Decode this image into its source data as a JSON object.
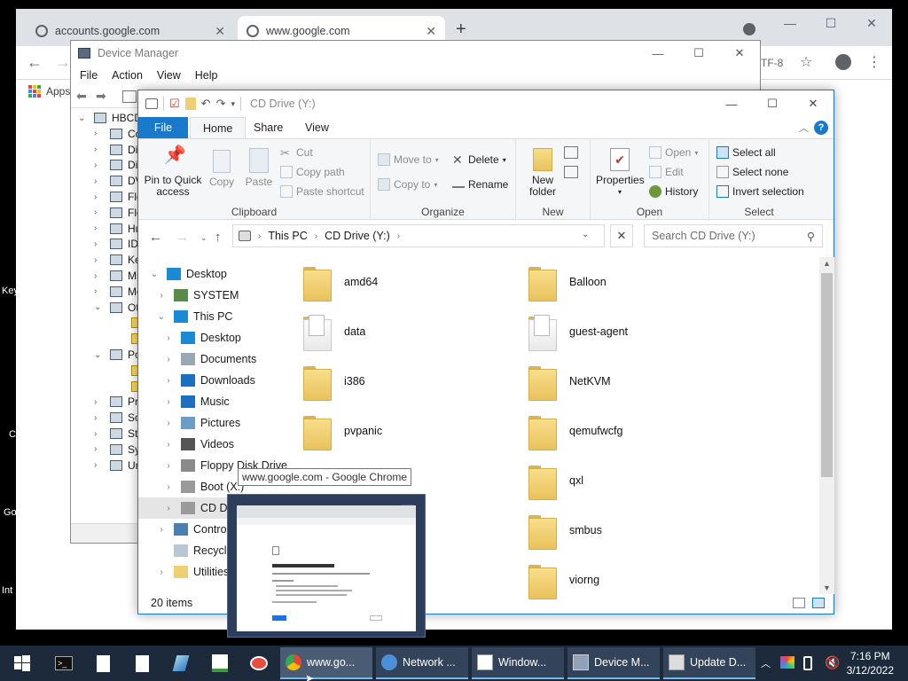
{
  "chrome": {
    "tabs": [
      {
        "title": "accounts.google.com"
      },
      {
        "title": "www.google.com"
      }
    ],
    "toolbar_right_text": "TF-8",
    "bookmarks_apps": "Apps"
  },
  "desktop_edge": {
    "labels": [
      "Key",
      "C",
      "Go",
      "Int"
    ]
  },
  "device_manager": {
    "title": "Device Manager",
    "menu": [
      "File",
      "Action",
      "View",
      "Help"
    ],
    "tree": [
      {
        "chev": "⌄",
        "text": "HBCD"
      },
      {
        "chev": "›",
        "text": "Co"
      },
      {
        "chev": "›",
        "text": "Dis"
      },
      {
        "chev": "›",
        "text": "Dis"
      },
      {
        "chev": "›",
        "text": "DV"
      },
      {
        "chev": "›",
        "text": "Flo"
      },
      {
        "chev": "›",
        "text": "Flo"
      },
      {
        "chev": "›",
        "text": "Hu"
      },
      {
        "chev": "›",
        "text": "IDI"
      },
      {
        "chev": "›",
        "text": "Ke"
      },
      {
        "chev": "›",
        "text": "Mi"
      },
      {
        "chev": "›",
        "text": "Mo"
      },
      {
        "chev": "⌄",
        "text": "Ot"
      },
      {
        "chev": "",
        "text": ""
      },
      {
        "chev": "",
        "text": ""
      },
      {
        "chev": "⌄",
        "text": "Po"
      },
      {
        "chev": "",
        "text": ""
      },
      {
        "chev": "",
        "text": ""
      },
      {
        "chev": "›",
        "text": "Pro"
      },
      {
        "chev": "›",
        "text": "So"
      },
      {
        "chev": "›",
        "text": "Sto"
      },
      {
        "chev": "›",
        "text": "Sy"
      },
      {
        "chev": "›",
        "text": "Un"
      }
    ]
  },
  "explorer": {
    "title": "CD Drive (Y:)",
    "tabs": [
      "File",
      "Home",
      "Share",
      "View"
    ],
    "ribbon": {
      "clipboard": {
        "label": "Clipboard",
        "pin": "Pin to Quick access",
        "copy": "Copy",
        "paste": "Paste",
        "cut": "Cut",
        "copy_path": "Copy path",
        "paste_shortcut": "Paste shortcut"
      },
      "organize": {
        "label": "Organize",
        "move_to": "Move to",
        "copy_to": "Copy to",
        "delete": "Delete",
        "rename": "Rename"
      },
      "new": {
        "label": "New",
        "new_folder": "New folder"
      },
      "open": {
        "label": "Open",
        "properties": "Properties",
        "open": "Open",
        "edit": "Edit",
        "history": "History"
      },
      "select": {
        "label": "Select",
        "select_all": "Select all",
        "select_none": "Select none",
        "invert_selection": "Invert selection"
      }
    },
    "address": {
      "crumbs": [
        "This PC",
        "CD Drive (Y:)"
      ]
    },
    "search_placeholder": "Search CD Drive (Y:)",
    "nav": [
      {
        "text": "Desktop",
        "chev": "⌄",
        "indent": 0,
        "icon": "desktop-icon"
      },
      {
        "text": "SYSTEM",
        "chev": "›",
        "indent": 1,
        "icon": "user-icon"
      },
      {
        "text": "This PC",
        "chev": "⌄",
        "indent": 1,
        "icon": "pc-icon"
      },
      {
        "text": "Desktop",
        "chev": "›",
        "indent": 2,
        "icon": "desktop-icon"
      },
      {
        "text": "Documents",
        "chev": "›",
        "indent": 2,
        "icon": "documents-icon"
      },
      {
        "text": "Downloads",
        "chev": "›",
        "indent": 2,
        "icon": "downloads-icon"
      },
      {
        "text": "Music",
        "chev": "›",
        "indent": 2,
        "icon": "music-icon"
      },
      {
        "text": "Pictures",
        "chev": "›",
        "indent": 2,
        "icon": "pictures-icon"
      },
      {
        "text": "Videos",
        "chev": "›",
        "indent": 2,
        "icon": "videos-icon"
      },
      {
        "text": "Floppy Disk Drive",
        "chev": "›",
        "indent": 2,
        "icon": "floppy-icon"
      },
      {
        "text": "Boot (X:)",
        "chev": "›",
        "indent": 2,
        "icon": "drive-icon"
      },
      {
        "text": "CD Drive",
        "chev": "›",
        "indent": 2,
        "icon": "cd-drive-icon",
        "highlight": true
      },
      {
        "text": "Control P",
        "chev": "›",
        "indent": 1,
        "icon": "control-panel-icon"
      },
      {
        "text": "Recycle B",
        "chev": "",
        "indent": 1,
        "icon": "recycle-bin-icon"
      },
      {
        "text": "Utilities",
        "chev": "›",
        "indent": 1,
        "icon": "folder-icon"
      }
    ],
    "files_col1": [
      {
        "name": "amd64",
        "type": "folder"
      },
      {
        "name": "data",
        "type": "folder-doc"
      },
      {
        "name": "i386",
        "type": "folder"
      },
      {
        "name": "pvpanic",
        "type": "folder"
      }
    ],
    "files_col2": [
      {
        "name": "Balloon",
        "type": "folder"
      },
      {
        "name": "guest-agent",
        "type": "folder-doc"
      },
      {
        "name": "NetKVM",
        "type": "folder"
      },
      {
        "name": "qemufwcfg",
        "type": "folder"
      },
      {
        "name": "qxl",
        "type": "folder"
      },
      {
        "name": "smbus",
        "type": "folder"
      },
      {
        "name": "viorng",
        "type": "folder"
      }
    ],
    "status": "20 items"
  },
  "tooltip": "www.google.com - Google Chrome",
  "taskbar": {
    "tasks": [
      {
        "label": "www.go...",
        "icon": "chrome-icon",
        "active": true
      },
      {
        "label": "Network ...",
        "icon": "network-icon"
      },
      {
        "label": "Window...",
        "icon": "window-icon"
      },
      {
        "label": "Device M...",
        "icon": "device-manager-icon"
      },
      {
        "label": "Update D...",
        "icon": "update-driver-icon"
      }
    ],
    "clock_time": "7:16 PM",
    "clock_date": "3/12/2022"
  },
  "colors": {
    "accent": "#1979ca",
    "taskbar": "#1d2a3c",
    "folder": "#f0cf74"
  }
}
